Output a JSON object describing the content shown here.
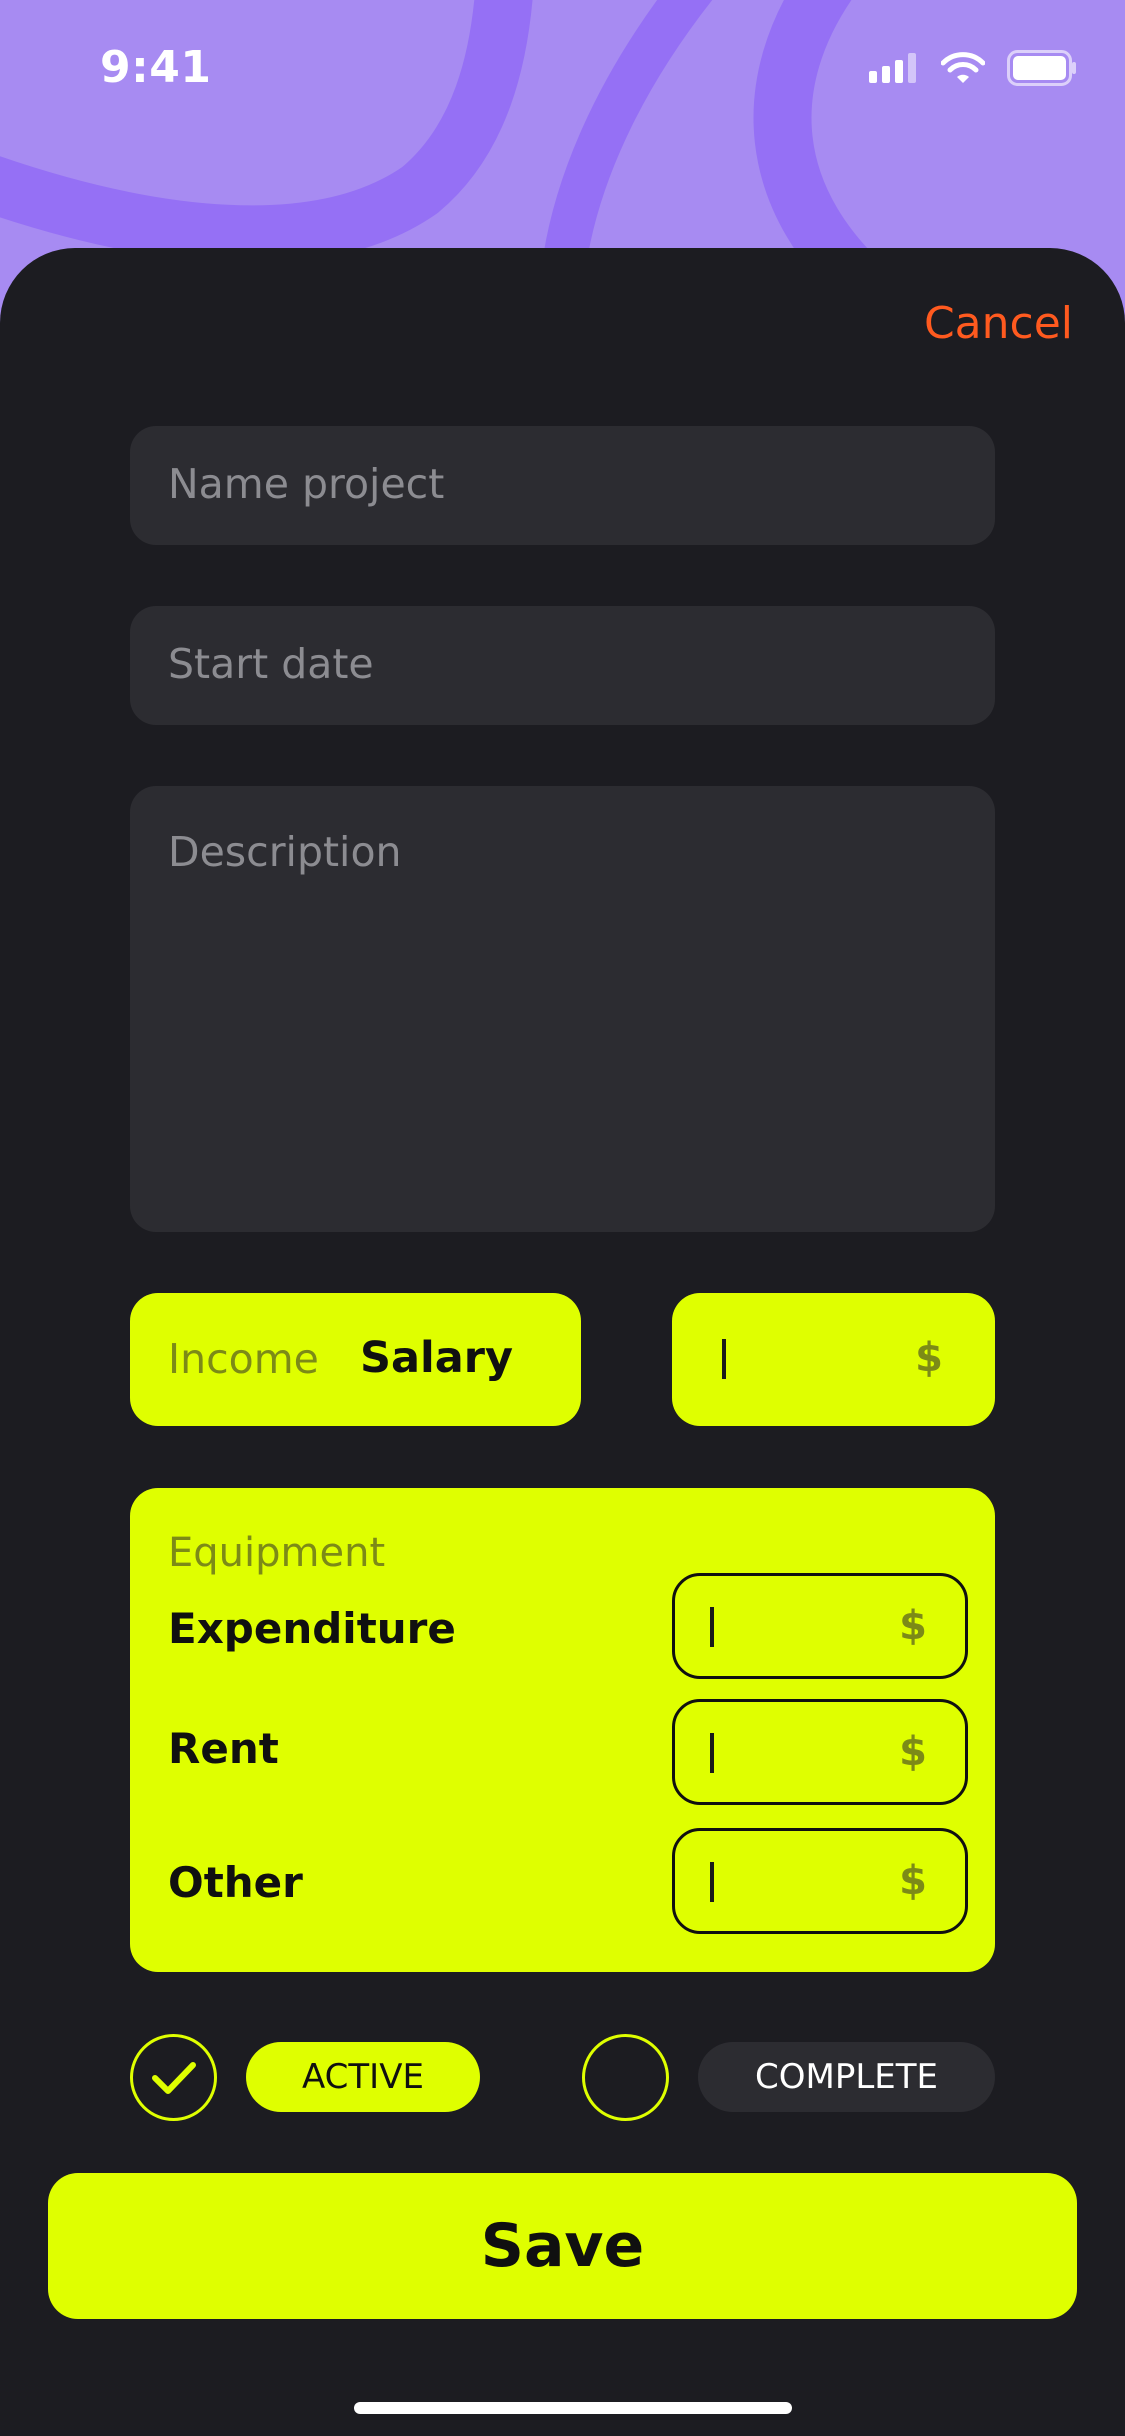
{
  "status_bar": {
    "time": "9:41"
  },
  "header": {
    "cancel_label": "Cancel"
  },
  "form": {
    "name_placeholder": "Name project",
    "date_placeholder": "Start date",
    "description_placeholder": "Description"
  },
  "income": {
    "label": "Income",
    "value": "Salary",
    "currency": "$"
  },
  "equipment": {
    "title": "Equipment",
    "rows": [
      {
        "label": "Expenditure",
        "currency": "$"
      },
      {
        "label": "Rent",
        "currency": "$"
      },
      {
        "label": "Other",
        "currency": "$"
      }
    ]
  },
  "status": {
    "active_label": "ACTIVE",
    "complete_label": "COMPLETE",
    "active_checked": true,
    "complete_checked": false
  },
  "save_label": "Save",
  "colors": {
    "background": "#A78BF2",
    "sheet": "#1C1C21",
    "field": "#2C2C31",
    "accent": "#DFFF00",
    "cancel": "#FF5A1F"
  }
}
